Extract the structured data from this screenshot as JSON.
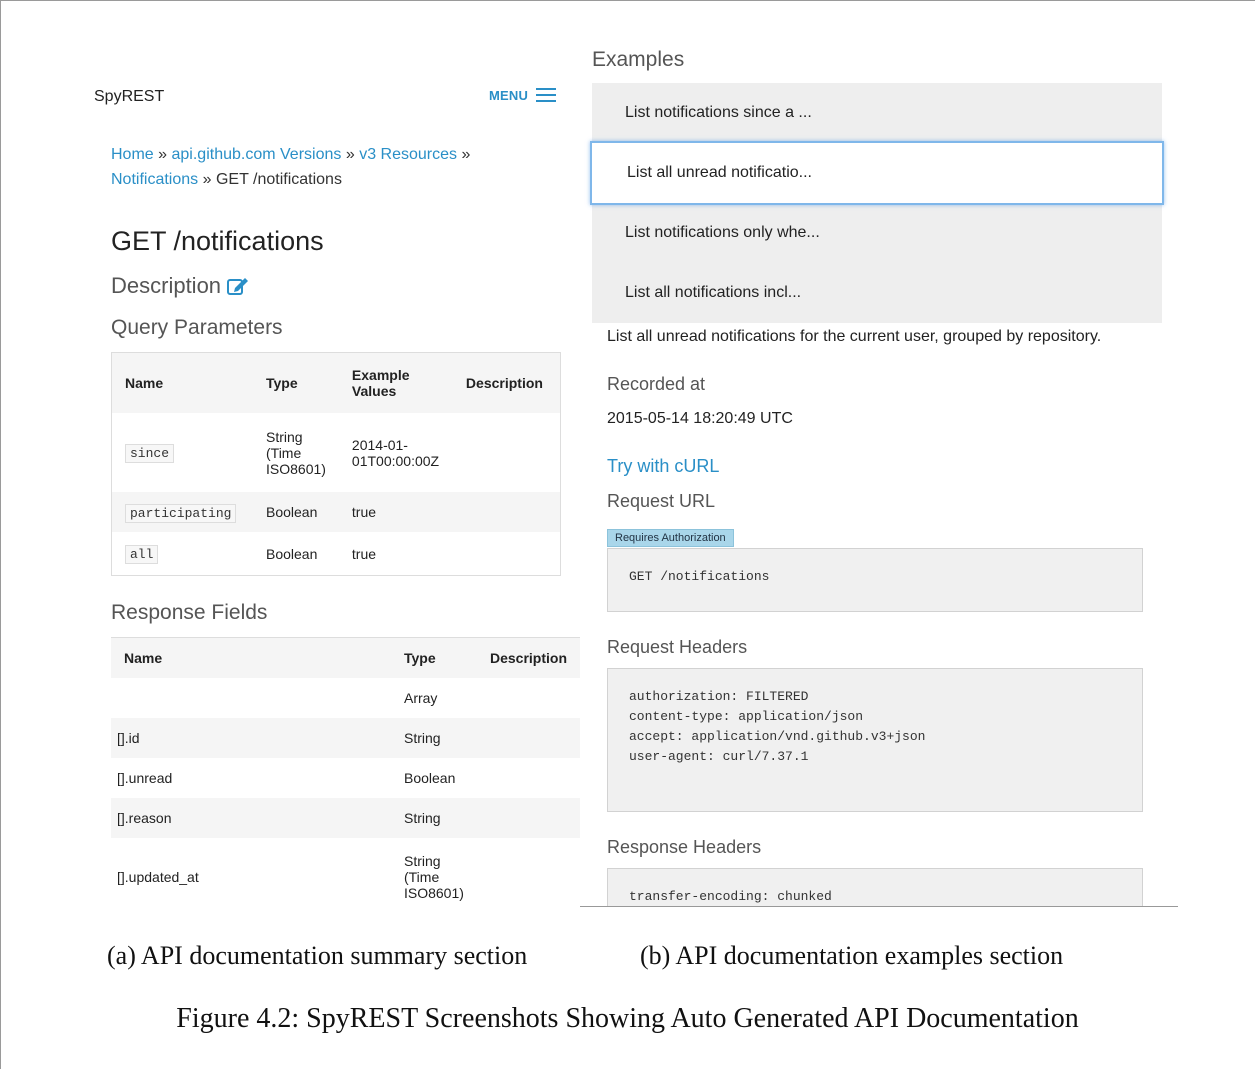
{
  "left": {
    "brand": "SpyREST",
    "menu_label": "MENU",
    "breadcrumb": {
      "home": "Home",
      "versions": "api.github.com Versions",
      "resources": "v3 Resources",
      "notifications": "Notifications",
      "sep": "»",
      "current": "GET /notifications"
    },
    "title": "GET /notifications",
    "description_heading": "Description",
    "query_heading": "Query Parameters",
    "query_table": {
      "headers": [
        "Name",
        "Type",
        "Example Values",
        "Description"
      ],
      "rows": [
        {
          "name": "since",
          "type": "String (Time ISO8601)",
          "example": "2014-01-01T00:00:00Z",
          "description": ""
        },
        {
          "name": "participating",
          "type": "Boolean",
          "example": "true",
          "description": ""
        },
        {
          "name": "all",
          "type": "Boolean",
          "example": "true",
          "description": ""
        }
      ]
    },
    "response_heading": "Response Fields",
    "response_table": {
      "headers": [
        "Name",
        "Type",
        "Description"
      ],
      "rows": [
        {
          "name": "",
          "type": "Array"
        },
        {
          "name": "[].id",
          "type": "String"
        },
        {
          "name": "[].unread",
          "type": "Boolean"
        },
        {
          "name": "[].reason",
          "type": "String"
        },
        {
          "name": "[].updated_at",
          "type": "String (Time ISO8601)"
        }
      ]
    }
  },
  "right": {
    "examples_heading": "Examples",
    "examples": [
      "List notifications since a ...",
      "List all unread notificatio...",
      "List notifications only whe...",
      "List all notifications incl..."
    ],
    "active_example": 1,
    "summary": "List all unread notifications for the current user, grouped by repository.",
    "recorded_heading": "Recorded at",
    "recorded_value": "2015-05-14 18:20:49 UTC",
    "try_curl": "Try with cURL",
    "request_url_heading": "Request URL",
    "auth_badge": "Requires Authorization",
    "request_url": "GET /notifications",
    "request_headers_heading": "Request Headers",
    "request_headers": [
      "authorization: FILTERED",
      "content-type: application/json",
      "accept: application/vnd.github.v3+json",
      "user-agent: curl/7.37.1"
    ],
    "response_headers_heading": "Response Headers",
    "response_headers": [
      "transfer-encoding: chunked"
    ]
  },
  "captions": {
    "a": "(a) API documentation summary section",
    "b": "(b) API documentation examples section",
    "figure": "Figure 4.2: SpyREST Screenshots Showing Auto Generated API Documentation"
  },
  "colors": {
    "link": "#2a8fc7",
    "badge": "#a9d6ea",
    "example_bg": "#eeeeee",
    "active_border": "#7fb7ea"
  }
}
